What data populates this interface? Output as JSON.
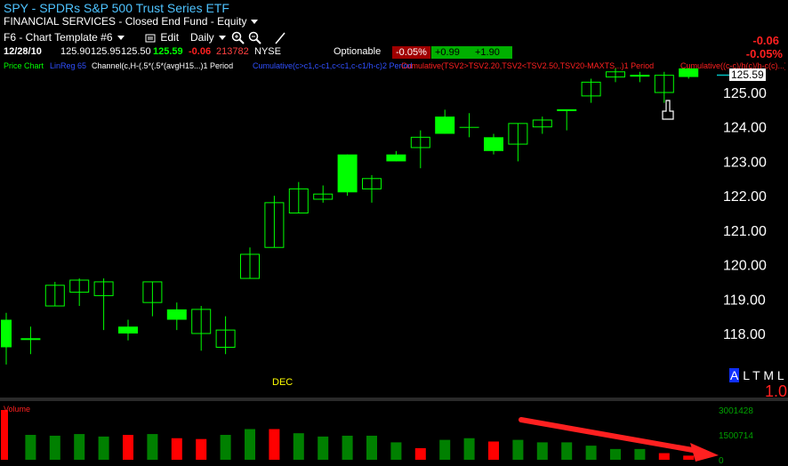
{
  "header": {
    "title": "SPY  - SPDRs S&P 500 Trust Series ETF",
    "subtitle": "FINANCIAL SERVICES - Closed End Fund - Equity"
  },
  "toolbar": {
    "template_label": "F6 - Chart Template #6",
    "edit_label": "Edit",
    "period_label": "Daily"
  },
  "quote": {
    "date": "12/28/10",
    "open": "125.90",
    "high": "125.95",
    "low": "125.50",
    "last": "125.59",
    "change": "-0.06",
    "volume": "213782",
    "exchange": "NYSE",
    "optionable_label": "Optionable",
    "pct_badge": "-0.05%",
    "up_badge_1": "+0.99",
    "up_badge_2": "+1.90",
    "right_change": "-0.06",
    "right_pct": "-0.05%"
  },
  "studies": {
    "price_chart": "Price Chart",
    "linreg": "LinReg 65",
    "channel": "Channel(c,H-(.5*(.5*(avgH15...)1 Period",
    "cumulative_blue": "Cumulative(c>c1,c-c1,c<c1,c-c1/h-c)2 Period",
    "cumulative_red": "Cumulative(TSV2>TSV2.20,TSV2<TSV2.50,TSV20-MAXTS...)1 Period",
    "cumulative_red2": "Cumulative((c-c)/h(c)/h-c(c)...)2"
  },
  "right_panel": {
    "alert_a": "A",
    "alert_rest": "L T M L",
    "scale": "1.0"
  },
  "colors": {
    "up_candle": "#00ff00",
    "hollow_candle": "#00ff00",
    "volume_up": "#008000",
    "volume_down": "#ff0000",
    "price_axis_text": "#ffffff",
    "volume_axis_text": "#00a000",
    "current_price_box": "#ffffff",
    "trend_arrow": "#ff2020"
  },
  "chart_data": [
    {
      "type": "candlestick",
      "title": "SPY",
      "y_axis_labels": [
        "125.00",
        "124.00",
        "123.00",
        "122.00",
        "121.00",
        "120.00",
        "119.00",
        "118.00"
      ],
      "ylim": [
        117.0,
        126.0
      ],
      "x_label_marker": "DEC",
      "current_price_label": "125.59",
      "candles": [
        {
          "o": 117.6,
          "h": 118.6,
          "l": 117.1,
          "c": 118.4,
          "fill": "solid"
        },
        {
          "o": 117.85,
          "h": 118.2,
          "l": 117.4,
          "c": 117.85,
          "fill": "hollow"
        },
        {
          "o": 118.8,
          "h": 119.5,
          "l": 118.8,
          "c": 119.4,
          "fill": "hollow"
        },
        {
          "o": 119.2,
          "h": 119.6,
          "l": 118.8,
          "c": 119.55,
          "fill": "hollow"
        },
        {
          "o": 119.1,
          "h": 119.6,
          "l": 118.1,
          "c": 119.5,
          "fill": "hollow"
        },
        {
          "o": 118.2,
          "h": 118.4,
          "l": 117.8,
          "c": 118.0,
          "fill": "solid"
        },
        {
          "o": 118.9,
          "h": 119.5,
          "l": 118.5,
          "c": 119.5,
          "fill": "hollow"
        },
        {
          "o": 118.4,
          "h": 118.9,
          "l": 118.1,
          "c": 118.7,
          "fill": "solid"
        },
        {
          "o": 118.0,
          "h": 118.8,
          "l": 117.5,
          "c": 118.7,
          "fill": "hollow"
        },
        {
          "o": 117.6,
          "h": 118.5,
          "l": 117.4,
          "c": 118.1,
          "fill": "hollow"
        },
        {
          "o": 119.6,
          "h": 120.5,
          "l": 119.6,
          "c": 120.3,
          "fill": "hollow"
        },
        {
          "o": 120.5,
          "h": 122.0,
          "l": 120.5,
          "c": 121.8,
          "fill": "hollow"
        },
        {
          "o": 121.5,
          "h": 122.4,
          "l": 121.5,
          "c": 122.2,
          "fill": "hollow"
        },
        {
          "o": 121.9,
          "h": 122.3,
          "l": 121.8,
          "c": 122.05,
          "fill": "hollow"
        },
        {
          "o": 123.2,
          "h": 123.2,
          "l": 122.0,
          "c": 122.1,
          "fill": "solid"
        },
        {
          "o": 122.2,
          "h": 122.6,
          "l": 121.8,
          "c": 122.5,
          "fill": "hollow"
        },
        {
          "o": 123.2,
          "h": 123.3,
          "l": 123.0,
          "c": 123.0,
          "fill": "solid"
        },
        {
          "o": 123.4,
          "h": 123.9,
          "l": 122.8,
          "c": 123.7,
          "fill": "hollow"
        },
        {
          "o": 124.3,
          "h": 124.5,
          "l": 123.8,
          "c": 123.8,
          "fill": "solid"
        },
        {
          "o": 124.0,
          "h": 124.4,
          "l": 123.7,
          "c": 124.0,
          "fill": "solid"
        },
        {
          "o": 123.7,
          "h": 123.8,
          "l": 123.2,
          "c": 123.3,
          "fill": "solid"
        },
        {
          "o": 123.5,
          "h": 124.1,
          "l": 123.0,
          "c": 124.1,
          "fill": "hollow"
        },
        {
          "o": 124.0,
          "h": 124.3,
          "l": 123.8,
          "c": 124.2,
          "fill": "hollow"
        },
        {
          "o": 124.5,
          "h": 124.5,
          "l": 123.9,
          "c": 124.5,
          "fill": "hollow"
        },
        {
          "o": 124.9,
          "h": 125.4,
          "l": 124.7,
          "c": 125.3,
          "fill": "hollow"
        },
        {
          "o": 125.45,
          "h": 125.7,
          "l": 125.3,
          "c": 125.6,
          "fill": "hollow"
        },
        {
          "o": 125.5,
          "h": 125.6,
          "l": 125.3,
          "c": 125.5,
          "fill": "hollow"
        },
        {
          "o": 125.0,
          "h": 125.6,
          "l": 124.7,
          "c": 125.5,
          "fill": "hollow"
        },
        {
          "o": 125.7,
          "h": 125.7,
          "l": 125.4,
          "c": 125.45,
          "fill": "solid"
        }
      ]
    },
    {
      "type": "bar",
      "title": "Volume",
      "y_axis_labels": [
        "3001428",
        "1500714",
        "0"
      ],
      "ylim": [
        0,
        3001428
      ],
      "values": [
        3000000,
        1500000,
        1450000,
        1550000,
        1400000,
        1500000,
        1550000,
        1300000,
        1250000,
        1500000,
        1850000,
        1850000,
        1600000,
        1400000,
        1450000,
        1450000,
        1050000,
        700000,
        1200000,
        1300000,
        1100000,
        1200000,
        1050000,
        1050000,
        850000,
        650000,
        650000,
        400000,
        250000
      ],
      "up": [
        false,
        true,
        true,
        true,
        true,
        false,
        true,
        false,
        false,
        true,
        true,
        false,
        true,
        true,
        true,
        true,
        true,
        false,
        true,
        true,
        false,
        true,
        true,
        true,
        true,
        true,
        true,
        false,
        false
      ]
    }
  ]
}
